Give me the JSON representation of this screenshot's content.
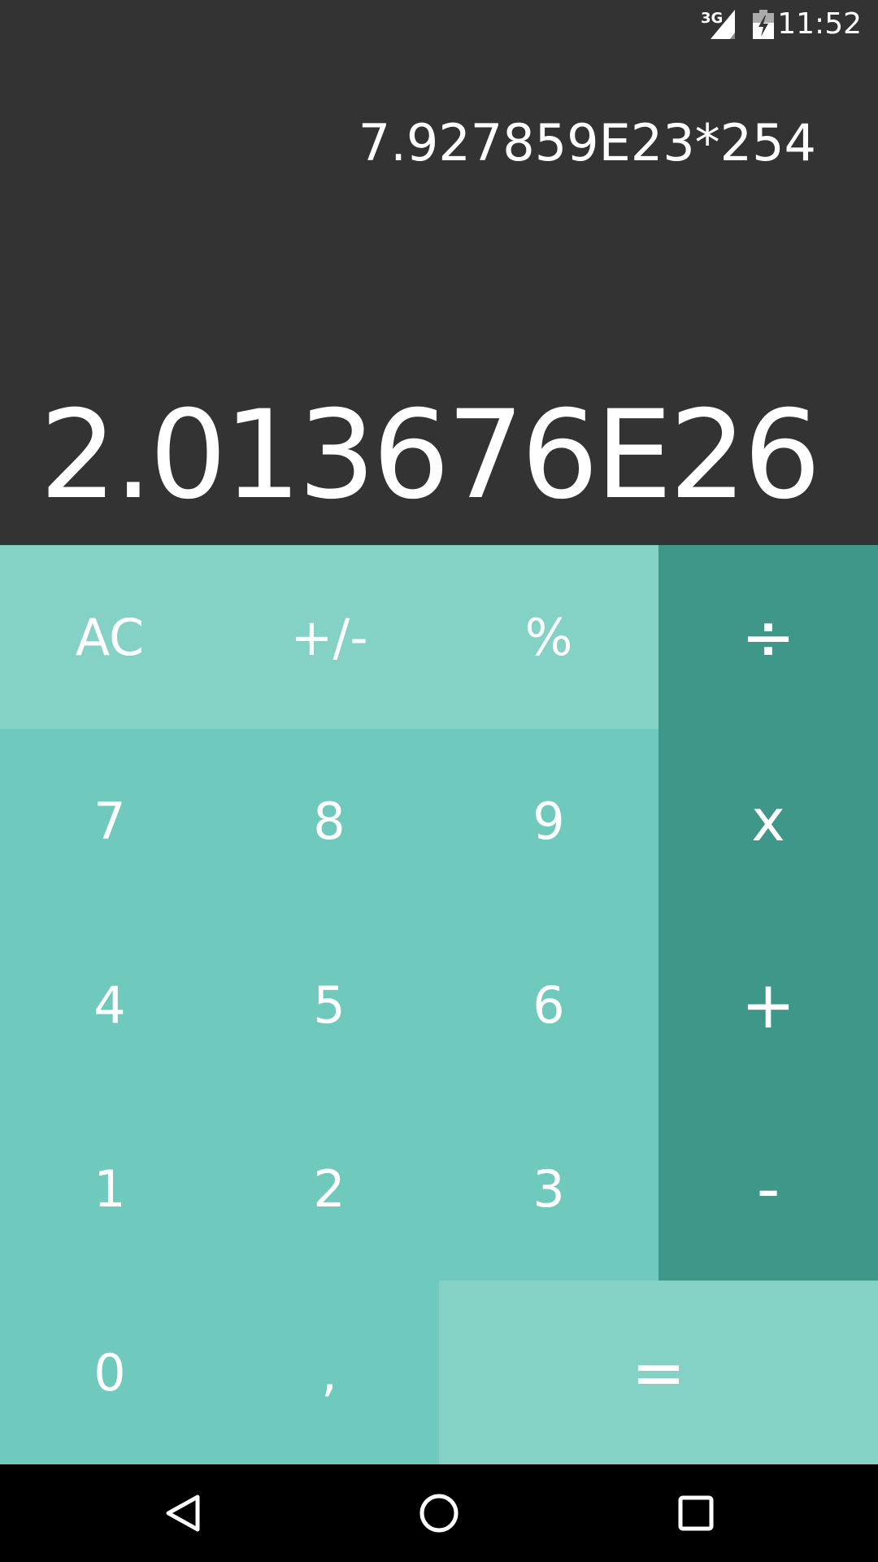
{
  "status_bar": {
    "network": "3G",
    "time": "11:52",
    "icons": [
      "signal-icon",
      "battery-charging-icon"
    ]
  },
  "display": {
    "expression": "7.927859E23*254",
    "result": "2.013676E26"
  },
  "keys": {
    "ac": "AC",
    "sign": "+/-",
    "percent": "%",
    "divide": "÷",
    "seven": "7",
    "eight": "8",
    "nine": "9",
    "multiply": "x",
    "four": "4",
    "five": "5",
    "six": "6",
    "plus": "+",
    "one": "1",
    "two": "2",
    "three": "3",
    "minus": "-",
    "zero": "0",
    "comma": ",",
    "equals": "="
  },
  "nav": {
    "icons": [
      "back-icon",
      "home-icon",
      "recents-icon"
    ]
  },
  "colors": {
    "display_bg": "#333333",
    "key_light": "#84d2c5",
    "key_mid": "#6fcabd",
    "key_dark": "#3e9789"
  }
}
